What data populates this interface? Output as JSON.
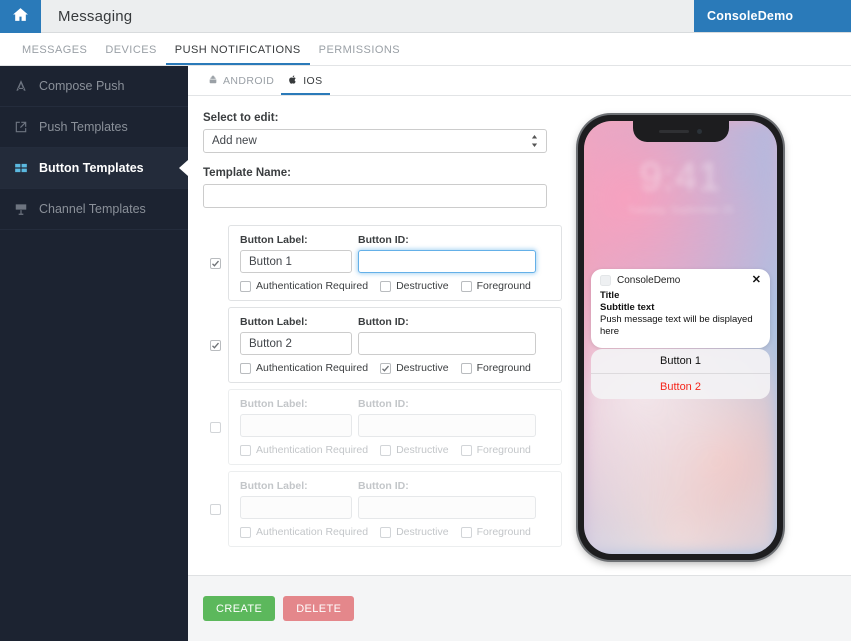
{
  "header": {
    "home_icon": "home-icon",
    "title": "Messaging",
    "console": "ConsoleDemo"
  },
  "nav_tabs": [
    {
      "label": "MESSAGES",
      "active": false
    },
    {
      "label": "DEVICES",
      "active": false
    },
    {
      "label": "PUSH NOTIFICATIONS",
      "active": true
    },
    {
      "label": "PERMISSIONS",
      "active": false
    }
  ],
  "sidebar": {
    "items": [
      {
        "label": "Compose Push",
        "icon": "compose-push-icon",
        "active": false
      },
      {
        "label": "Push Templates",
        "icon": "push-templates-icon",
        "active": false
      },
      {
        "label": "Button Templates",
        "icon": "button-templates-icon",
        "active": true
      },
      {
        "label": "Channel Templates",
        "icon": "channel-templates-icon",
        "active": false
      }
    ]
  },
  "platform_tabs": [
    {
      "label": "ANDROID",
      "icon": "android-icon",
      "active": false
    },
    {
      "label": "IOS",
      "icon": "apple-icon",
      "active": true
    }
  ],
  "form": {
    "select_label": "Select to edit:",
    "select_value": "Add new",
    "template_name_label": "Template Name:",
    "template_name_value": "",
    "template_name_placeholder": ""
  },
  "button_rows": [
    {
      "enabled": true,
      "label_heading": "Button Label:",
      "id_heading": "Button ID:",
      "label_value": "Button 1",
      "id_value": "",
      "id_focused": true,
      "options": [
        {
          "label": "Authentication Required",
          "checked": false
        },
        {
          "label": "Destructive",
          "checked": false
        },
        {
          "label": "Foreground",
          "checked": false
        }
      ]
    },
    {
      "enabled": true,
      "label_heading": "Button Label:",
      "id_heading": "Button ID:",
      "label_value": "Button 2",
      "id_value": "",
      "id_focused": false,
      "options": [
        {
          "label": "Authentication Required",
          "checked": false
        },
        {
          "label": "Destructive",
          "checked": true
        },
        {
          "label": "Foreground",
          "checked": false
        }
      ]
    },
    {
      "enabled": false,
      "label_heading": "Button Label:",
      "id_heading": "Button ID:",
      "label_value": "",
      "id_value": "",
      "id_focused": false,
      "options": [
        {
          "label": "Authentication Required",
          "checked": false
        },
        {
          "label": "Destructive",
          "checked": false
        },
        {
          "label": "Foreground",
          "checked": false
        }
      ]
    },
    {
      "enabled": false,
      "label_heading": "Button Label:",
      "id_heading": "Button ID:",
      "label_value": "",
      "id_value": "",
      "id_focused": false,
      "options": [
        {
          "label": "Authentication Required",
          "checked": false
        },
        {
          "label": "Destructive",
          "checked": false
        },
        {
          "label": "Foreground",
          "checked": false
        }
      ]
    }
  ],
  "preview": {
    "lock_time": "9:41",
    "lock_date": "Tuesday, September 25",
    "notification": {
      "app_name": "ConsoleDemo",
      "close_icon": "close-icon",
      "title": "Title",
      "subtitle": "Subtitle text",
      "body": "Push message text will be displayed here"
    },
    "action_buttons": [
      {
        "label": "Button 1",
        "destructive": false
      },
      {
        "label": "Button 2",
        "destructive": true
      }
    ]
  },
  "footer": {
    "create_label": "CREATE",
    "delete_label": "DELETE"
  },
  "colors": {
    "brand_blue": "#2a7ab9",
    "sidebar_bg": "#1c2331",
    "active_icon": "#5bb9e0",
    "create_green": "#5cb85c",
    "delete_red": "#e4878b",
    "destructive_text": "#f5271c"
  }
}
